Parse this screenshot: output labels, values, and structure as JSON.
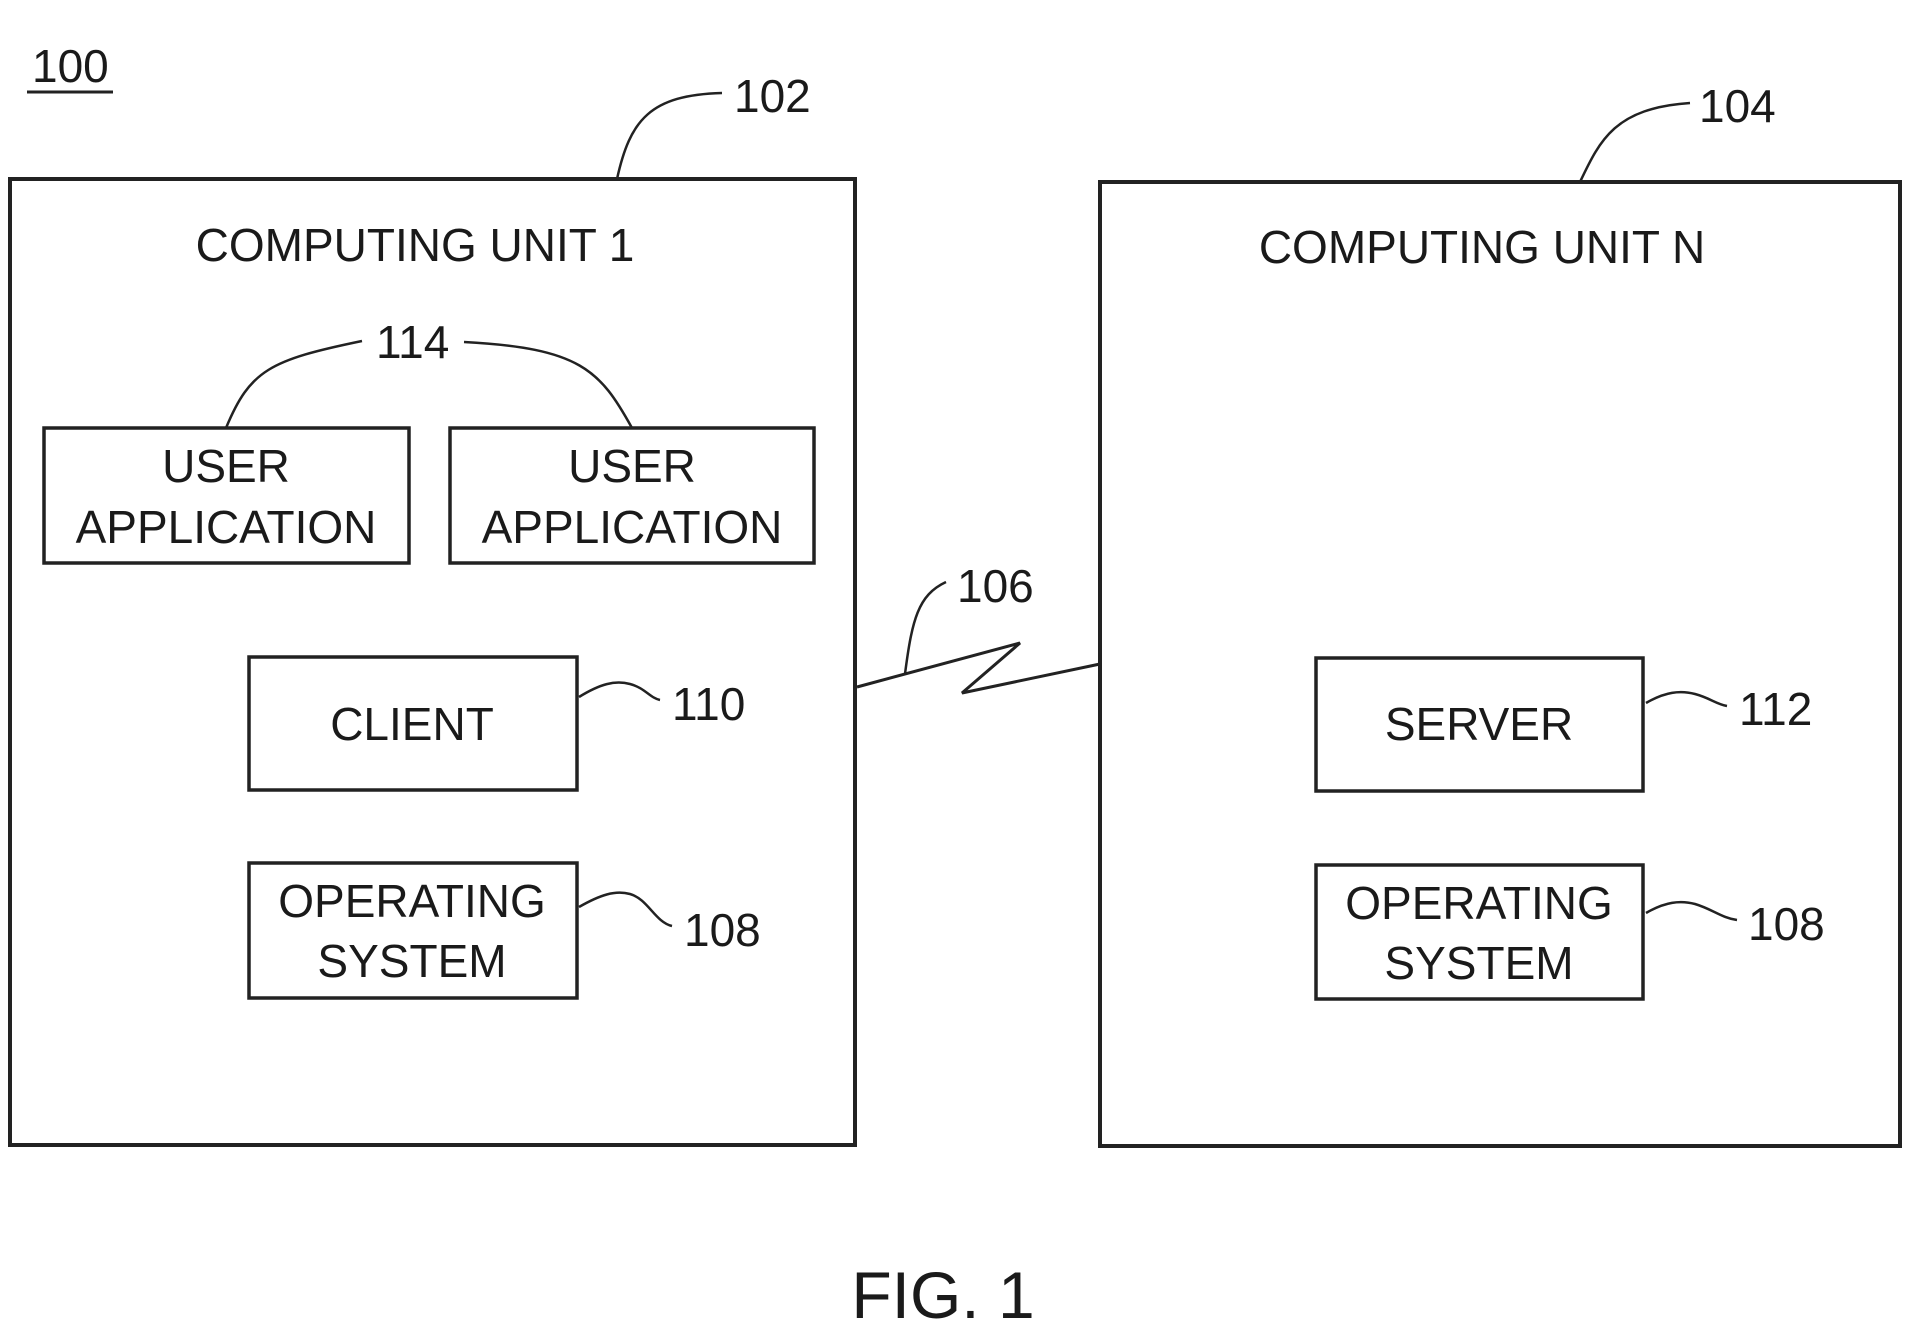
{
  "figure": {
    "system_ref": "100",
    "caption": "FIG. 1"
  },
  "units": [
    {
      "ref": "102",
      "title": "COMPUTING UNIT 1",
      "user_apps_ref": "114",
      "user_apps": [
        {
          "line1": "USER",
          "line2": "APPLICATION"
        },
        {
          "line1": "USER",
          "line2": "APPLICATION"
        }
      ],
      "client": {
        "label": "CLIENT",
        "ref": "110"
      },
      "os": {
        "line1": "OPERATING",
        "line2": "SYSTEM",
        "ref": "108"
      }
    },
    {
      "ref": "104",
      "title": "COMPUTING UNIT N",
      "server": {
        "label": "SERVER",
        "ref": "112"
      },
      "os": {
        "line1": "OPERATING",
        "line2": "SYSTEM",
        "ref": "108"
      }
    }
  ],
  "network": {
    "ref": "106"
  }
}
